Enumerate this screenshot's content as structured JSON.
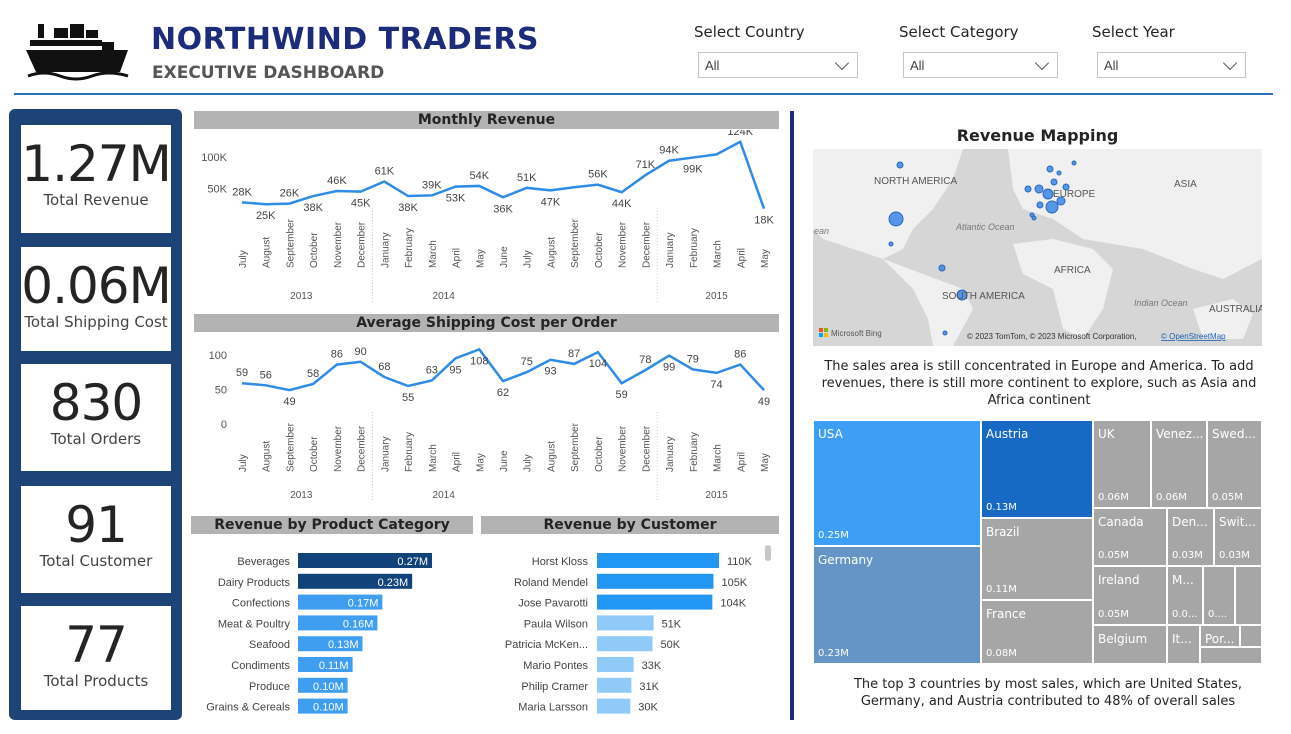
{
  "header": {
    "title": "NORTHWIND TRADERS",
    "subtitle": "EXECUTIVE DASHBOARD",
    "accent": "#1c2b7a",
    "filters": [
      {
        "label": "Select Country",
        "value": "All"
      },
      {
        "label": "Select Category",
        "value": "All"
      },
      {
        "label": "Select Year",
        "value": "All"
      }
    ]
  },
  "kpis": [
    {
      "value": "1.27M",
      "label": "Total Revenue"
    },
    {
      "value": "0.06M",
      "label": "Total Shipping Cost"
    },
    {
      "value": "830",
      "label": "Total Orders"
    },
    {
      "value": "91",
      "label": "Total Customer"
    },
    {
      "value": "77",
      "label": "Total Products"
    }
  ],
  "monthly_revenue": {
    "title": "Monthly Revenue",
    "months": [
      "July",
      "August",
      "September",
      "October",
      "November",
      "December",
      "January",
      "February",
      "March",
      "April",
      "May",
      "June",
      "July",
      "August",
      "September",
      "October",
      "November",
      "December",
      "January",
      "February",
      "March",
      "April",
      "May"
    ],
    "labels": [
      "28K",
      "25K",
      "26K",
      "38K",
      "46K",
      "45K",
      "61K",
      "38K",
      "39K",
      "53K",
      "54K",
      "36K",
      "51K",
      "47K",
      "",
      "56K",
      "44K",
      "71K",
      "94K",
      "99K",
      "",
      "124K",
      "18K"
    ],
    "years": [
      "2013",
      "2014",
      "2015"
    ],
    "y_ticks": [
      "100K",
      "50K"
    ]
  },
  "avg_shipping": {
    "title": "Average Shipping Cost per Order",
    "labels": [
      "59",
      "56",
      "49",
      "58",
      "86",
      "90",
      "68",
      "55",
      "63",
      "95",
      "108",
      "62",
      "75",
      "93",
      "87",
      "104",
      "59",
      "78",
      "99",
      "79",
      "74",
      "86",
      "49"
    ],
    "y_ticks": [
      "100",
      "50",
      "0"
    ]
  },
  "product_category": {
    "title": "Revenue by Product Category",
    "items": [
      {
        "name": "Beverages",
        "label": "0.27M"
      },
      {
        "name": "Dairy Products",
        "label": "0.23M"
      },
      {
        "name": "Confections",
        "label": "0.17M"
      },
      {
        "name": "Meat & Poultry",
        "label": "0.16M"
      },
      {
        "name": "Seafood",
        "label": "0.13M"
      },
      {
        "name": "Condiments",
        "label": "0.11M"
      },
      {
        "name": "Produce",
        "label": "0.10M"
      },
      {
        "name": "Grains & Cereals",
        "label": "0.10M"
      }
    ]
  },
  "customer": {
    "title": "Revenue by Customer",
    "items": [
      {
        "name": "Horst Kloss",
        "label": "110K"
      },
      {
        "name": "Roland Mendel",
        "label": "105K"
      },
      {
        "name": "Jose Pavarotti",
        "label": "104K"
      },
      {
        "name": "Paula Wilson",
        "label": "51K"
      },
      {
        "name": "Patricia McKen...",
        "label": "50K"
      },
      {
        "name": "Mario Pontes",
        "label": "33K"
      },
      {
        "name": "Philip Cramer",
        "label": "31K"
      },
      {
        "name": "Maria Larsson",
        "label": "30K"
      }
    ]
  },
  "map": {
    "title": "Revenue Mapping",
    "regions": [
      "NORTH AMERICA",
      "EUROPE",
      "ASIA",
      "AFRICA",
      "SOUTH AMERICA",
      "AUSTRALIA"
    ],
    "oceans": [
      "Atlantic Ocean",
      "Indian Ocean",
      "ean"
    ],
    "provider": "Microsoft Bing",
    "copyright": "© 2023 TomTom, © 2023 Microsoft Corporation, ",
    "osm": "© OpenStreetMap",
    "note": "The sales area is still concentrated in Europe and America. To add revenues, there is still more continent to explore, such as Asia and Africa continent"
  },
  "treemap": {
    "cells": [
      {
        "name": "USA",
        "value": "0.25M",
        "color": "#3c9ef4"
      },
      {
        "name": "Germany",
        "value": "0.23M",
        "color": "#6595c6"
      },
      {
        "name": "Austria",
        "value": "0.13M",
        "color": "#1769c4"
      },
      {
        "name": "Brazil",
        "value": "0.11M",
        "color": "#a6a6a6"
      },
      {
        "name": "France",
        "value": "0.08M",
        "color": "#a6a6a6"
      },
      {
        "name": "UK",
        "value": "0.06M",
        "color": "#a6a6a6"
      },
      {
        "name": "Venez...",
        "value": "0.06M",
        "color": "#a6a6a6"
      },
      {
        "name": "Swed...",
        "value": "0.05M",
        "color": "#a6a6a6"
      },
      {
        "name": "Canada",
        "value": "0.05M",
        "color": "#a6a6a6"
      },
      {
        "name": "Den...",
        "value": "0.03M",
        "color": "#a6a6a6"
      },
      {
        "name": "Swit...",
        "value": "0.03M",
        "color": "#a6a6a6"
      },
      {
        "name": "Ireland",
        "value": "0.05M",
        "color": "#a6a6a6"
      },
      {
        "name": "M...",
        "value": "0.0...",
        "color": "#a6a6a6"
      },
      {
        "name": "",
        "value": "0....",
        "color": "#a6a6a6"
      },
      {
        "name": "Belgium",
        "value": "",
        "color": "#a6a6a6"
      },
      {
        "name": "It...",
        "value": "",
        "color": "#a6a6a6"
      },
      {
        "name": "Por...",
        "value": "",
        "color": "#a6a6a6"
      }
    ],
    "note": "The top 3 countries by most sales, which are United States, Germany, and Austria contributed to 48% of overall sales"
  },
  "chart_data": [
    {
      "type": "line",
      "title": "Monthly Revenue",
      "x": [
        "2013-07",
        "2013-08",
        "2013-09",
        "2013-10",
        "2013-11",
        "2013-12",
        "2014-01",
        "2014-02",
        "2014-03",
        "2014-04",
        "2014-05",
        "2014-06",
        "2014-07",
        "2014-08",
        "2014-09",
        "2014-10",
        "2014-11",
        "2014-12",
        "2015-01",
        "2015-02",
        "2015-03",
        "2015-04",
        "2015-05"
      ],
      "series": [
        {
          "values": [
            28,
            25,
            26,
            38,
            46,
            45,
            61,
            38,
            39,
            53,
            54,
            36,
            51,
            47,
            52,
            56,
            44,
            71,
            94,
            99,
            104,
            124,
            18
          ]
        }
      ],
      "ylabel": "",
      "unit": "K",
      "ylim": [
        0,
        130
      ]
    },
    {
      "type": "line",
      "title": "Average Shipping Cost per Order",
      "x": [
        "2013-07",
        "2013-08",
        "2013-09",
        "2013-10",
        "2013-11",
        "2013-12",
        "2014-01",
        "2014-02",
        "2014-03",
        "2014-04",
        "2014-05",
        "2014-06",
        "2014-07",
        "2014-08",
        "2014-09",
        "2014-10",
        "2014-11",
        "2014-12",
        "2015-01",
        "2015-02",
        "2015-03",
        "2015-04",
        "2015-05"
      ],
      "series": [
        {
          "values": [
            59,
            56,
            49,
            58,
            86,
            90,
            68,
            55,
            63,
            95,
            108,
            62,
            75,
            93,
            87,
            104,
            59,
            78,
            99,
            79,
            74,
            86,
            49
          ]
        }
      ],
      "ylim": [
        0,
        110
      ]
    },
    {
      "type": "bar",
      "title": "Revenue by Product Category",
      "categories": [
        "Beverages",
        "Dairy Products",
        "Confections",
        "Meat & Poultry",
        "Seafood",
        "Condiments",
        "Produce",
        "Grains & Cereals"
      ],
      "values": [
        0.27,
        0.23,
        0.17,
        0.16,
        0.13,
        0.11,
        0.1,
        0.1
      ],
      "unit": "M"
    },
    {
      "type": "bar",
      "title": "Revenue by Customer",
      "categories": [
        "Horst Kloss",
        "Roland Mendel",
        "Jose Pavarotti",
        "Paula Wilson",
        "Patricia McKen...",
        "Mario Pontes",
        "Philip Cramer",
        "Maria Larsson"
      ],
      "values": [
        110,
        105,
        104,
        51,
        50,
        33,
        31,
        30
      ],
      "unit": "K"
    }
  ]
}
